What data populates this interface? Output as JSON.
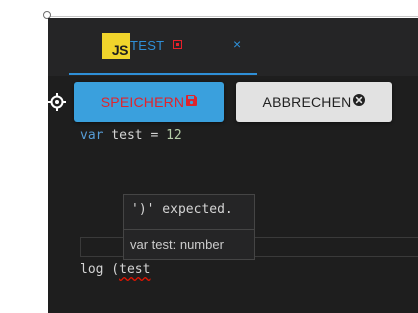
{
  "tab": {
    "icon_text": "JS",
    "label": "TEST",
    "close_glyph": "×"
  },
  "buttons": {
    "save_label": "SPEICHERN",
    "cancel_label": "ABBRECHEN"
  },
  "code": {
    "line1_keyword": "var",
    "line1_rest": " test = ",
    "line1_number": "12",
    "line2_prefix": "log (",
    "line2_error_word": "test"
  },
  "hover": {
    "error_message": "')' expected.",
    "type_info": "var test: number"
  },
  "colors": {
    "accent": "#2f8fd7",
    "save_text": "#e0242c",
    "error": "#e51400",
    "js_badge": "#f0d42b"
  },
  "icons": {
    "tab_file": "js-icon",
    "modified": "unsaved-indicator-icon",
    "save": "floppy-disk-icon",
    "cancel": "close-circle-icon",
    "gutter": "crosshair-target-icon"
  }
}
